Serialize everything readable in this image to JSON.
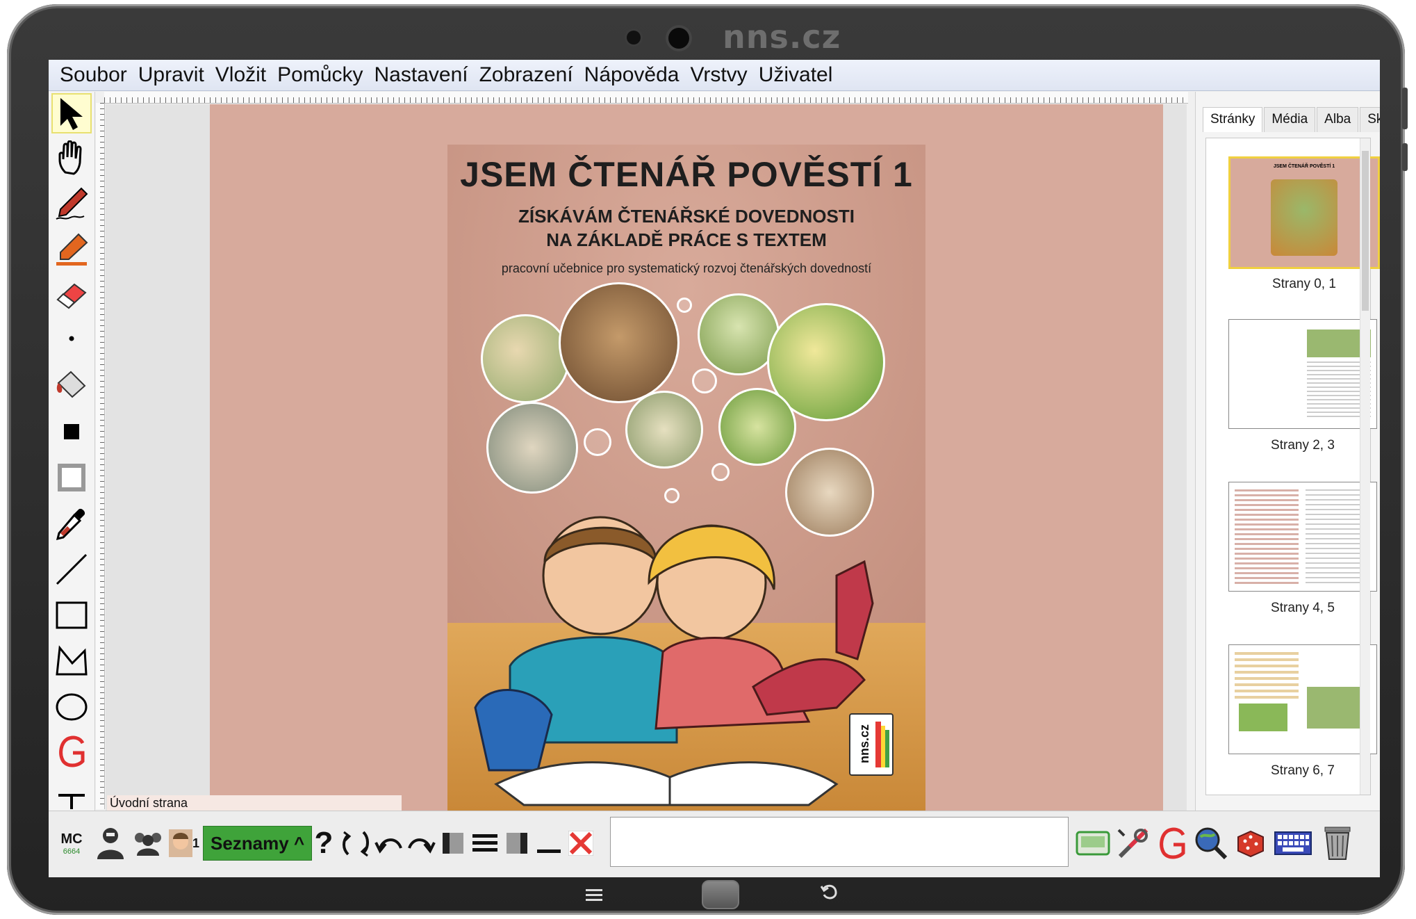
{
  "device": {
    "brand": "nns.cz"
  },
  "menu": [
    "Soubor",
    "Upravit",
    "Vložit",
    "Pomůcky",
    "Nastavení",
    "Zobrazení",
    "Nápověda",
    "Vrstvy",
    "Uživatel"
  ],
  "left_tools": [
    "arrow-pointer-icon",
    "hand-icon",
    "pen-icon",
    "highlighter-icon",
    "eraser-icon",
    "dot-icon",
    "fill-bucket-icon",
    "filled-square-icon",
    "hollow-square-icon",
    "eyedropper-icon",
    "line-icon",
    "rectangle-icon",
    "polygon-icon",
    "ellipse-icon",
    "geogebra-icon",
    "text-icon"
  ],
  "cover": {
    "title": "JSEM ČTENÁŘ POVĚSTÍ 1",
    "subtitle_line1": "ZÍSKÁVÁM ČTENÁŘSKÉ DOVEDNOSTI",
    "subtitle_line2": "NA ZÁKLADĚ PRÁCE S TEXTEM",
    "description": "pracovní učebnice pro systematický rozvoj čtenářských dovedností",
    "logo_text": "nns.cz"
  },
  "page_label": "Úvodní strana",
  "right_panel": {
    "tabs": [
      "Stránky",
      "Média",
      "Alba",
      "Skupiny"
    ],
    "active_tab": 0,
    "thumbnails": [
      {
        "label": "Strany 0, 1",
        "mini_title": "JSEM ČTENÁŘ POVĚSTÍ 1",
        "selected": true
      },
      {
        "label": "Strany 2, 3",
        "selected": false
      },
      {
        "label": "Strany 4, 5",
        "selected": false
      },
      {
        "label": "Strany 6, 7",
        "selected": false
      }
    ]
  },
  "bottom": {
    "mc_label": "MC",
    "mc_number": "6664",
    "user_number": "1",
    "seznamy": "Seznamy ^",
    "help": "?"
  },
  "colors": {
    "accent_green": "#3fa33a",
    "page_bg": "#d7aa9c",
    "selection": "#f0d040"
  }
}
